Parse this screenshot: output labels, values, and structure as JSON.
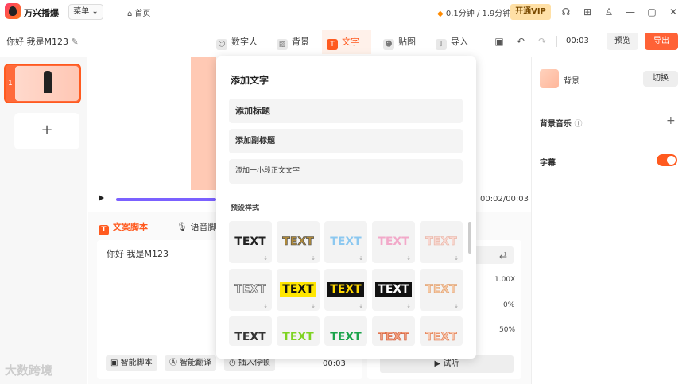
{
  "app": {
    "name": "万兴播爆",
    "menu_label": "菜单",
    "home_label": "首页",
    "usage": "0.1分钟 / 1.9分钟",
    "vip_label": "开通VIP"
  },
  "project": {
    "title": "你好 我是M123",
    "time": "00:03",
    "preview_label": "预览",
    "export_label": "导出"
  },
  "tabs": [
    {
      "label": "数字人",
      "icon": "avatar-icon"
    },
    {
      "label": "背景",
      "icon": "background-icon"
    },
    {
      "label": "文字",
      "icon": "text-icon"
    },
    {
      "label": "贴图",
      "icon": "sticker-icon"
    },
    {
      "label": "导入",
      "icon": "import-icon"
    }
  ],
  "slides": [
    {
      "number": "1"
    }
  ],
  "player": {
    "duration": "00:02/00:03",
    "progress": 1.0
  },
  "script": {
    "tabs": [
      "文案脚本",
      "语音脚"
    ],
    "text": "你好 我是M123",
    "buttons": [
      "智能脚本",
      "智能翻译",
      "插入停顿"
    ],
    "time": "00:03"
  },
  "voice": {
    "speed": "1.00X",
    "pitch": "0%",
    "volume": "50%",
    "listen_label": "试听"
  },
  "right": {
    "background_label": "背景",
    "switch_label": "切换",
    "music_label": "背景音乐",
    "subtitle_label": "字幕",
    "subtitle_on": true
  },
  "popup": {
    "title": "添加文字",
    "options": [
      "添加标题",
      "添加副标题",
      "添加一小段正文文字"
    ],
    "preset_label": "预设样式",
    "tile_text": "TEXT",
    "tiles": [
      {
        "color": "#222",
        "bg": "transparent",
        "stroke": "none"
      },
      {
        "color": "#b08a3a",
        "bg": "transparent",
        "stroke": "#444"
      },
      {
        "color": "#8cc8f0",
        "bg": "transparent",
        "stroke": "none"
      },
      {
        "color": "#f2a9c9",
        "bg": "transparent",
        "stroke": "none"
      },
      {
        "color": "#f8d7d0",
        "bg": "transparent",
        "stroke": "#e8b0a0"
      },
      {
        "color": "#eee",
        "bg": "transparent",
        "stroke": "#444"
      },
      {
        "color": "#111",
        "bg": "#ffe600",
        "stroke": "none"
      },
      {
        "color": "#ffd800",
        "bg": "#111",
        "stroke": "none"
      },
      {
        "color": "#fff",
        "bg": "#111",
        "stroke": "none"
      },
      {
        "color": "#f5c9a5",
        "bg": "transparent",
        "stroke": "#e09a66"
      },
      {
        "color": "#333",
        "bg": "transparent",
        "stroke": "none"
      },
      {
        "color": "#7ed321",
        "bg": "transparent",
        "stroke": "none"
      },
      {
        "color": "#1aa34a",
        "bg": "transparent",
        "stroke": "none"
      },
      {
        "color": "#f0a080",
        "bg": "transparent",
        "stroke": "#d0502a"
      },
      {
        "color": "#f7c8b0",
        "bg": "transparent",
        "stroke": "#e07040"
      }
    ]
  },
  "watermark": "大数跨境"
}
